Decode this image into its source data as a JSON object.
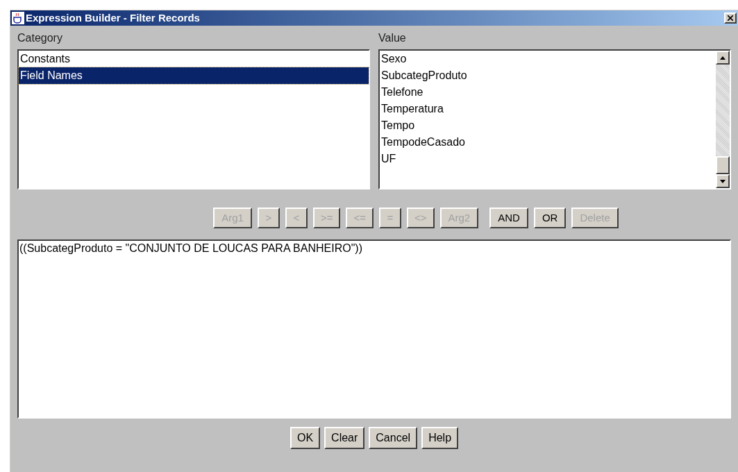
{
  "window": {
    "title": "Expression Builder - Filter Records"
  },
  "category": {
    "label": "Category",
    "items": [
      {
        "label": "Constants",
        "selected": false
      },
      {
        "label": "Field Names",
        "selected": true
      }
    ]
  },
  "value": {
    "label": "Value",
    "items": [
      {
        "label": "Sexo",
        "selected": false
      },
      {
        "label": "SubcategProduto",
        "selected": false
      },
      {
        "label": "Telefone",
        "selected": false
      },
      {
        "label": "Temperatura",
        "selected": false
      },
      {
        "label": "Tempo",
        "selected": false
      },
      {
        "label": "TempodeCasado",
        "selected": false
      },
      {
        "label": "UF",
        "selected": false
      }
    ]
  },
  "operators": [
    {
      "label": "Arg1",
      "disabled": true
    },
    {
      "label": ">",
      "disabled": true
    },
    {
      "label": "<",
      "disabled": true
    },
    {
      "label": ">=",
      "disabled": true
    },
    {
      "label": "<=",
      "disabled": true
    },
    {
      "label": "=",
      "disabled": true
    },
    {
      "label": "<>",
      "disabled": true
    },
    {
      "label": "Arg2",
      "disabled": true
    }
  ],
  "logic": [
    {
      "label": "AND",
      "disabled": false
    },
    {
      "label": "OR",
      "disabled": false
    },
    {
      "label": "Delete",
      "disabled": true
    }
  ],
  "expression": "((SubcategProduto = \"CONJUNTO DE LOUCAS PARA BANHEIRO\"))",
  "buttons": [
    "OK",
    "Clear",
    "Cancel",
    "Help"
  ]
}
